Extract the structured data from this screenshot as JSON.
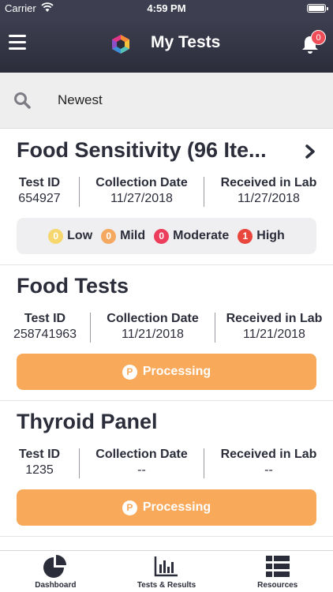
{
  "status_bar": {
    "carrier": "Carrier",
    "time": "4:59 PM"
  },
  "nav": {
    "title": "My Tests",
    "notification_count": "0",
    "menu_icon": "hamburger-icon",
    "bell_icon": "bell-icon"
  },
  "search": {
    "sort_label": "Newest",
    "icon": "search-icon"
  },
  "labels": {
    "test_id": "Test ID",
    "collection_date": "Collection Date",
    "received_in_lab": "Received in Lab",
    "processing": "Processing",
    "processing_badge": "P"
  },
  "tests": [
    {
      "title": "Food Sensitivity (96 Ite...",
      "test_id": "654927",
      "collection_date": "11/27/2018",
      "received_date": "11/27/2018",
      "results": [
        {
          "label": "Low",
          "count": "0",
          "color": "#f5d76e"
        },
        {
          "label": "Mild",
          "count": "0",
          "color": "#f4a860"
        },
        {
          "label": "Moderate",
          "count": "0",
          "color": "#ec3d5c"
        },
        {
          "label": "High",
          "count": "1",
          "color": "#e9473e"
        }
      ]
    },
    {
      "title": "Food Tests",
      "test_id": "258741963",
      "collection_date": "11/21/2018",
      "received_date": "11/21/2018",
      "status": "Processing"
    },
    {
      "title": "Thyroid Panel",
      "test_id": "1235",
      "collection_date": "--",
      "received_date": "--",
      "status": "Processing"
    }
  ],
  "tab_bar": [
    {
      "label": "Dashboard",
      "icon": "pie-chart-icon"
    },
    {
      "label": "Tests & Results",
      "icon": "bar-chart-icon"
    },
    {
      "label": "Resources",
      "icon": "list-icon"
    }
  ],
  "colors": {
    "header": "#3d3f50",
    "processing": "#f8a95a",
    "badge": "#ef4d58"
  }
}
